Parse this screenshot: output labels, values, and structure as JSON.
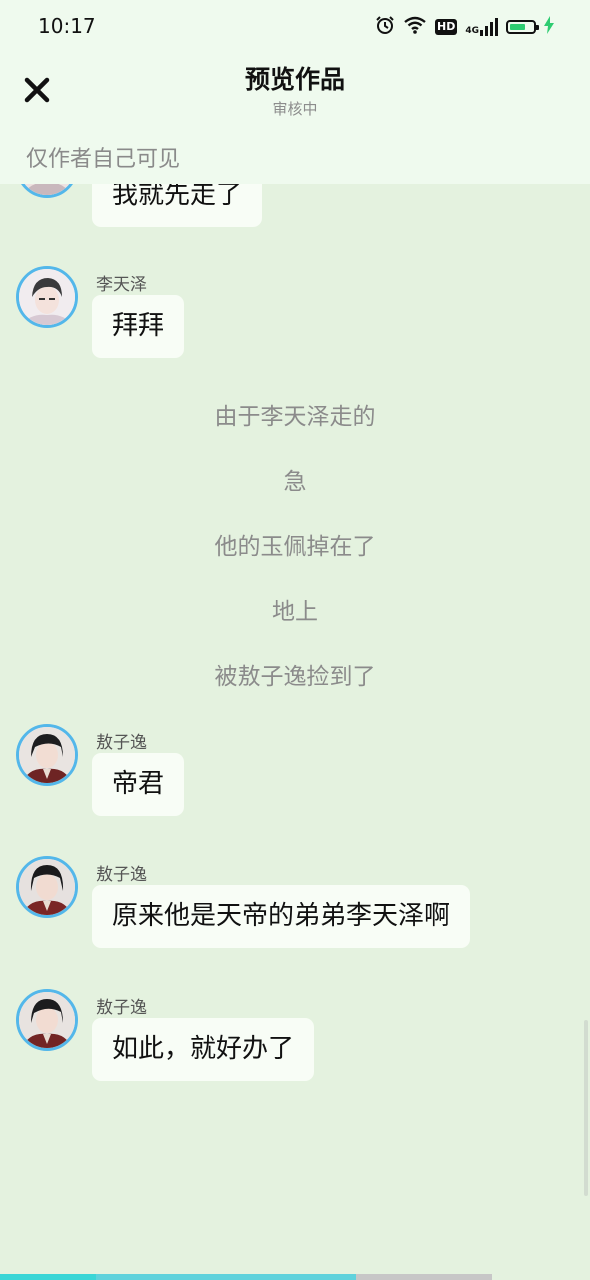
{
  "status_bar": {
    "time": "10:17",
    "hd": "HD",
    "network": "4G",
    "battery_level": 0.72
  },
  "header": {
    "title": "预览作品",
    "subtitle": "审核中",
    "visibility_note": "仅作者自己可见"
  },
  "messages": [
    {
      "type": "bubble",
      "text": "我就先走了"
    },
    {
      "type": "bubble",
      "sender": "李天泽",
      "text": "拜拜"
    },
    {
      "type": "narration",
      "text": "由于李天泽走的"
    },
    {
      "type": "narration",
      "text": "急"
    },
    {
      "type": "narration",
      "text": "他的玉佩掉在了"
    },
    {
      "type": "narration",
      "text": "地上"
    },
    {
      "type": "narration",
      "text": "被敖子逸捡到了"
    },
    {
      "type": "bubble",
      "sender": "敖子逸",
      "text": "帝君"
    },
    {
      "type": "bubble",
      "sender": "敖子逸",
      "text": "原来他是天帝的弟弟李天泽啊"
    },
    {
      "type": "bubble",
      "sender": "敖子逸",
      "text": "如此，就好办了"
    }
  ],
  "reading_progress": 0.72,
  "colors": {
    "background": "#e4f2df",
    "header_bg": "#effaee",
    "bubble_bg": "#f8fdf6",
    "avatar_ring": "#53b7ea",
    "progress": "#3ad6d6"
  }
}
